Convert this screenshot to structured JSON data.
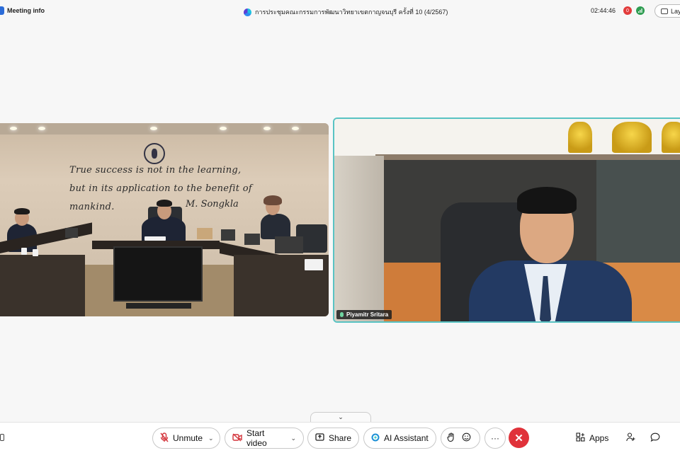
{
  "topbar": {
    "meeting_info_label": "Meeting info",
    "meeting_title": "การประชุมคณะกรรมการพัฒนาวิทยาเขตกาญจนบุรี ครั้งที่ 10 (4/2567)",
    "clock": "02:44:46",
    "recording_badge": "0",
    "layout_button_label": "Lay",
    "icons": [
      "info-icon",
      "webex-logo-icon",
      "recording-icon",
      "network-signal-icon",
      "layout-icon"
    ]
  },
  "videos": {
    "left": {
      "wall_quote": "True success is not in the learning, but in its application to the benefit of mankind.",
      "wall_quote_signature": "M. Songkla"
    },
    "right": {
      "participant_name": "Piyamitr Sritara"
    }
  },
  "controls": {
    "unmute_label": "Unmute",
    "start_video_label": "Start video",
    "share_label": "Share",
    "ai_assistant_label": "AI Assistant",
    "more_label": "···",
    "end_label": "✕",
    "apps_label": "Apps",
    "icons": [
      "microphone-muted-icon",
      "video-off-icon",
      "share-screen-icon",
      "ai-assistant-icon",
      "raise-hand-icon",
      "reactions-icon",
      "more-options-icon",
      "end-call-icon",
      "apps-icon",
      "participants-icon",
      "chat-icon",
      "collapse-chevron-icon"
    ]
  },
  "colors": {
    "active_speaker_border": "#59c3c3",
    "end_call": "#e0323a",
    "muted_icon": "#d3333a"
  }
}
